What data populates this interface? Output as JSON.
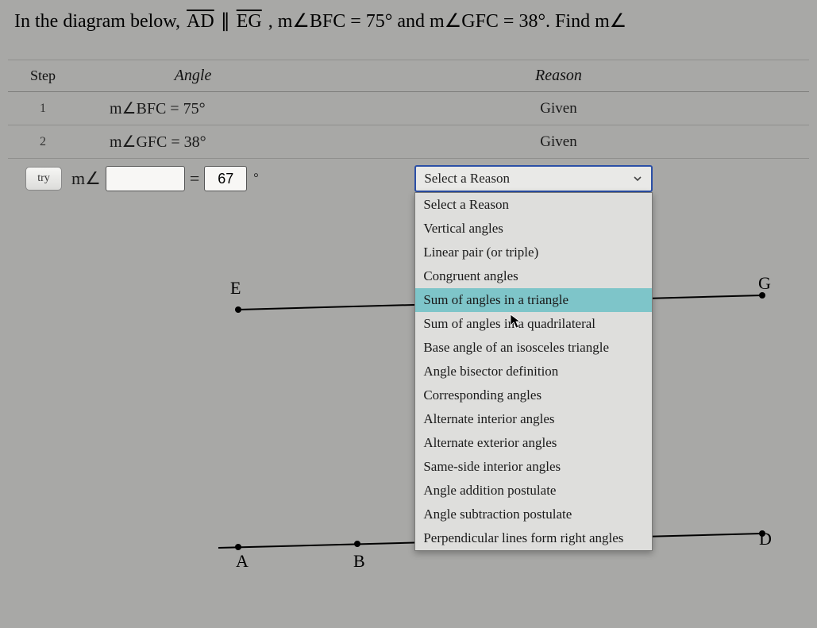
{
  "problem": {
    "prefix": "In the diagram below,  ",
    "seg1": "AD",
    "parallel": " ∥ ",
    "seg2": "EG",
    "mid": ",   m∠BFC = 75° and m∠GFC = 38°. Find m∠"
  },
  "headers": {
    "step": "Step",
    "angle": "Angle",
    "reason": "Reason"
  },
  "rows": [
    {
      "step": "1",
      "angle": "m∠BFC = 75°",
      "reason": "Given"
    },
    {
      "step": "2",
      "angle": "m∠GFC = 38°",
      "reason": "Given"
    }
  ],
  "tryRow": {
    "tryLabel": "try",
    "mAngle": "m∠",
    "angleValue": "",
    "equals": "=",
    "degValue": "67",
    "degSym": "°",
    "selectPlaceholder": "Select a Reason"
  },
  "reasonOptions": [
    "Select a Reason",
    "Vertical angles",
    "Linear pair (or triple)",
    "Congruent angles",
    "Sum of angles in a triangle",
    "Sum of angles in a quadrilateral",
    "Base angle of an isosceles triangle",
    "Angle bisector definition",
    "Corresponding angles",
    "Alternate interior angles",
    "Alternate exterior angles",
    "Same-side interior angles",
    "Angle addition postulate",
    "Angle subtraction postulate",
    "Perpendicular lines form right angles"
  ],
  "highlightedReasonIndex": 4,
  "points": {
    "E": "E",
    "G": "G",
    "A": "A",
    "B": "B",
    "D": "D"
  }
}
